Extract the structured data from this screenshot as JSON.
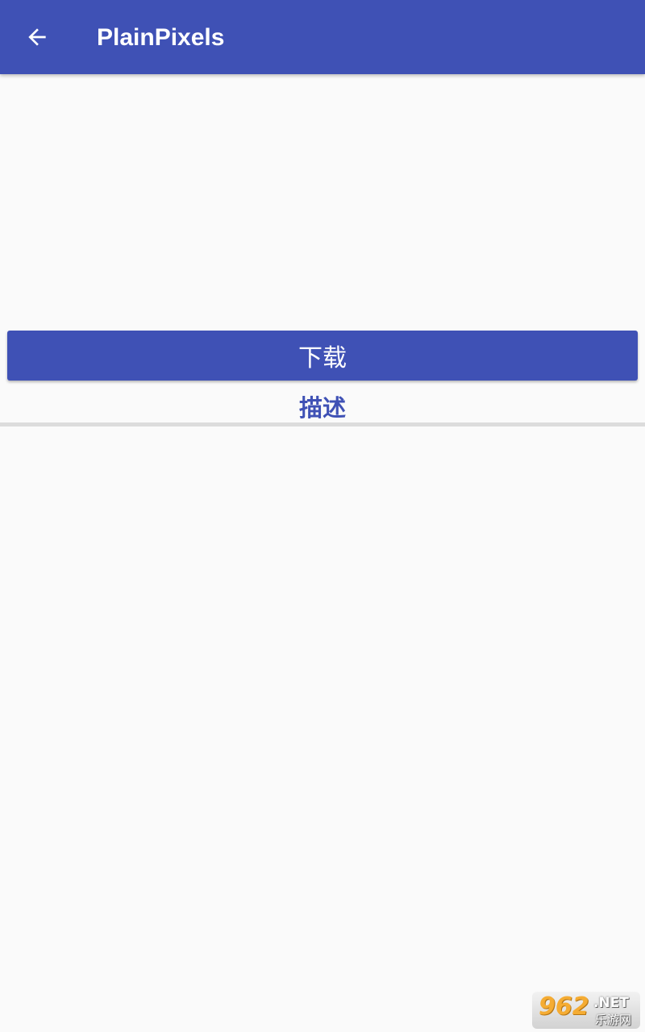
{
  "appbar": {
    "title": "PlainPixels",
    "back_icon": "arrow-left-icon",
    "color": "#3f51b5"
  },
  "actions": {
    "download_label": "下载"
  },
  "tabs": {
    "description_label": "描述"
  },
  "watermark": {
    "number": "962",
    "domain": ".NET",
    "site_name": "乐游网"
  }
}
